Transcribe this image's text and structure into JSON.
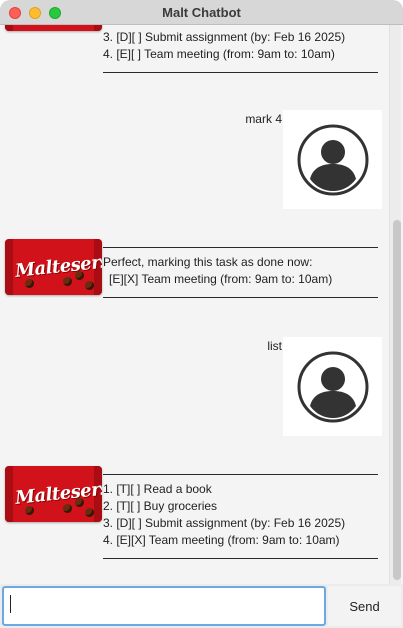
{
  "window": {
    "title": "Malt Chatbot"
  },
  "messages": {
    "m1": {
      "lines": [
        "3. [D][ ] Submit assignment (by: Feb 16 2025)",
        "4. [E][ ] Team meeting (from: 9am to: 10am)"
      ]
    },
    "u1": {
      "text": "mark 4"
    },
    "m2": {
      "lines": [
        "Perfect, marking this task as done now:",
        "  [E][X] Team meeting (from: 9am to: 10am)"
      ]
    },
    "u2": {
      "text": "list"
    },
    "m3": {
      "lines": [
        "1. [T][ ] Read a book",
        "2. [T][ ] Buy groceries",
        "3. [D][ ] Submit assignment (by: Feb 16 2025)",
        "4. [E][X] Team meeting (from: 9am to: 10am)"
      ]
    }
  },
  "bot_avatar": {
    "brand_text": "Maltesers",
    "icon": "maltesers-logo",
    "color": "#d2121b"
  },
  "user_avatar": {
    "icon": "user-profile-icon",
    "color": "#333333"
  },
  "input": {
    "value": "",
    "placeholder": ""
  },
  "send_button": {
    "label": "Send"
  },
  "colors": {
    "titlebar": "#d7d7d7",
    "chat_bg": "#f4f4f4",
    "focus": "#6aa8e6"
  }
}
